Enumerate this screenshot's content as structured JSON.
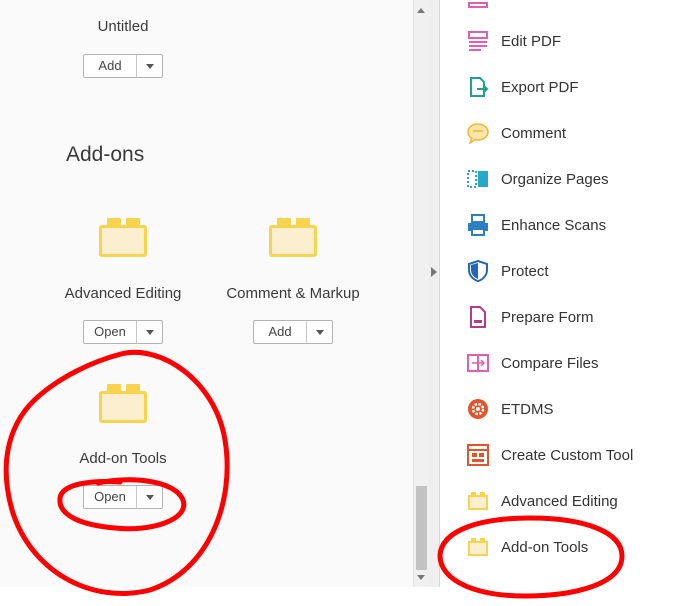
{
  "left_panel": {
    "top_tile": {
      "label": "Untitled",
      "button": "Add"
    },
    "section_title": "Add-ons",
    "addons": [
      {
        "label": "Advanced Editing",
        "button": "Open"
      },
      {
        "label": "Comment & Markup",
        "button": "Add"
      },
      {
        "label": "Add-on Tools",
        "button": "Open"
      }
    ]
  },
  "tools": [
    {
      "label": "Edit PDF",
      "icon": "edit-pdf-icon",
      "color": "#e05fb3"
    },
    {
      "label": "Export PDF",
      "icon": "export-pdf-icon",
      "color": "#1fa48a"
    },
    {
      "label": "Comment",
      "icon": "comment-icon",
      "color": "#f2b530"
    },
    {
      "label": "Organize Pages",
      "icon": "organize-pages-icon",
      "color": "#25a9c9"
    },
    {
      "label": "Enhance Scans",
      "icon": "enhance-scans-icon",
      "color": "#2c7fc4"
    },
    {
      "label": "Protect",
      "icon": "protect-shield-icon",
      "color": "#2466b7"
    },
    {
      "label": "Prepare Form",
      "icon": "prepare-form-icon",
      "color": "#b43b8f"
    },
    {
      "label": "Compare Files",
      "icon": "compare-files-icon",
      "color": "#e05fb3"
    },
    {
      "label": "ETDMS",
      "icon": "etdms-gear-icon",
      "color": "#e3542c"
    },
    {
      "label": "Create Custom Tool",
      "icon": "create-custom-tool-icon",
      "color": "#e3542c"
    },
    {
      "label": "Advanced Editing",
      "icon": "advanced-editing-addon-icon",
      "color": "#f9d34d"
    },
    {
      "label": "Add-on Tools",
      "icon": "addon-tools-icon",
      "color": "#f9d34d"
    }
  ],
  "colors": {
    "addon_yellow": "#f9d34d",
    "addon_fill": "#fcefcf",
    "annotation_red": "#ff0000"
  }
}
